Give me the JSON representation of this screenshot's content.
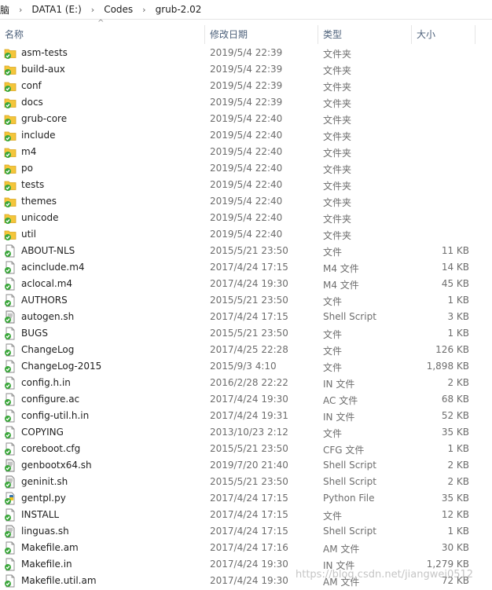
{
  "breadcrumb": {
    "items": [
      "脑",
      "DATA1 (E:)",
      "Codes",
      "grub-2.02"
    ],
    "separator": "›"
  },
  "columns": {
    "name": "名称",
    "date": "修改日期",
    "type": "类型",
    "size": "大小"
  },
  "files": [
    {
      "name": "asm-tests",
      "date": "2019/5/4 22:39",
      "type": "文件夹",
      "size": "",
      "kind": "folder"
    },
    {
      "name": "build-aux",
      "date": "2019/5/4 22:39",
      "type": "文件夹",
      "size": "",
      "kind": "folder"
    },
    {
      "name": "conf",
      "date": "2019/5/4 22:39",
      "type": "文件夹",
      "size": "",
      "kind": "folder"
    },
    {
      "name": "docs",
      "date": "2019/5/4 22:39",
      "type": "文件夹",
      "size": "",
      "kind": "folder"
    },
    {
      "name": "grub-core",
      "date": "2019/5/4 22:40",
      "type": "文件夹",
      "size": "",
      "kind": "folder"
    },
    {
      "name": "include",
      "date": "2019/5/4 22:40",
      "type": "文件夹",
      "size": "",
      "kind": "folder"
    },
    {
      "name": "m4",
      "date": "2019/5/4 22:40",
      "type": "文件夹",
      "size": "",
      "kind": "folder"
    },
    {
      "name": "po",
      "date": "2019/5/4 22:40",
      "type": "文件夹",
      "size": "",
      "kind": "folder"
    },
    {
      "name": "tests",
      "date": "2019/5/4 22:40",
      "type": "文件夹",
      "size": "",
      "kind": "folder"
    },
    {
      "name": "themes",
      "date": "2019/5/4 22:40",
      "type": "文件夹",
      "size": "",
      "kind": "folder"
    },
    {
      "name": "unicode",
      "date": "2019/5/4 22:40",
      "type": "文件夹",
      "size": "",
      "kind": "folder"
    },
    {
      "name": "util",
      "date": "2019/5/4 22:40",
      "type": "文件夹",
      "size": "",
      "kind": "folder"
    },
    {
      "name": "ABOUT-NLS",
      "date": "2015/5/21 23:50",
      "type": "文件",
      "size": "11 KB",
      "kind": "file"
    },
    {
      "name": "acinclude.m4",
      "date": "2017/4/24 17:15",
      "type": "M4 文件",
      "size": "14 KB",
      "kind": "file"
    },
    {
      "name": "aclocal.m4",
      "date": "2017/4/24 19:30",
      "type": "M4 文件",
      "size": "45 KB",
      "kind": "file"
    },
    {
      "name": "AUTHORS",
      "date": "2015/5/21 23:50",
      "type": "文件",
      "size": "1 KB",
      "kind": "file"
    },
    {
      "name": "autogen.sh",
      "date": "2017/4/24 17:15",
      "type": "Shell Script",
      "size": "3 KB",
      "kind": "script"
    },
    {
      "name": "BUGS",
      "date": "2015/5/21 23:50",
      "type": "文件",
      "size": "1 KB",
      "kind": "file"
    },
    {
      "name": "ChangeLog",
      "date": "2017/4/25 22:28",
      "type": "文件",
      "size": "126 KB",
      "kind": "file"
    },
    {
      "name": "ChangeLog-2015",
      "date": "2015/9/3 4:10",
      "type": "文件",
      "size": "1,898 KB",
      "kind": "file"
    },
    {
      "name": "config.h.in",
      "date": "2016/2/28 22:22",
      "type": "IN 文件",
      "size": "2 KB",
      "kind": "file"
    },
    {
      "name": "configure.ac",
      "date": "2017/4/24 19:30",
      "type": "AC 文件",
      "size": "68 KB",
      "kind": "file"
    },
    {
      "name": "config-util.h.in",
      "date": "2017/4/24 19:31",
      "type": "IN 文件",
      "size": "52 KB",
      "kind": "file"
    },
    {
      "name": "COPYING",
      "date": "2013/10/23 2:12",
      "type": "文件",
      "size": "35 KB",
      "kind": "file"
    },
    {
      "name": "coreboot.cfg",
      "date": "2015/5/21 23:50",
      "type": "CFG 文件",
      "size": "1 KB",
      "kind": "file"
    },
    {
      "name": "genbootx64.sh",
      "date": "2019/7/20 21:40",
      "type": "Shell Script",
      "size": "2 KB",
      "kind": "script"
    },
    {
      "name": "geninit.sh",
      "date": "2015/5/21 23:50",
      "type": "Shell Script",
      "size": "2 KB",
      "kind": "script"
    },
    {
      "name": "gentpl.py",
      "date": "2017/4/24 17:15",
      "type": "Python File",
      "size": "35 KB",
      "kind": "python"
    },
    {
      "name": "INSTALL",
      "date": "2017/4/24 17:15",
      "type": "文件",
      "size": "12 KB",
      "kind": "file"
    },
    {
      "name": "linguas.sh",
      "date": "2017/4/24 17:15",
      "type": "Shell Script",
      "size": "1 KB",
      "kind": "script"
    },
    {
      "name": "Makefile.am",
      "date": "2017/4/24 17:16",
      "type": "AM 文件",
      "size": "30 KB",
      "kind": "file"
    },
    {
      "name": "Makefile.in",
      "date": "2017/4/24 19:30",
      "type": "IN 文件",
      "size": "1,279 KB",
      "kind": "file"
    },
    {
      "name": "Makefile.util.am",
      "date": "2017/4/24 19:30",
      "type": "AM 文件",
      "size": "72 KB",
      "kind": "file"
    }
  ],
  "watermark": "https://blog.csdn.net/jiangwei0512",
  "colors": {
    "folder": "#f4c63a",
    "check": "#3aa63a",
    "header_text": "#4c607a",
    "meta_text": "#6d6d6d"
  }
}
